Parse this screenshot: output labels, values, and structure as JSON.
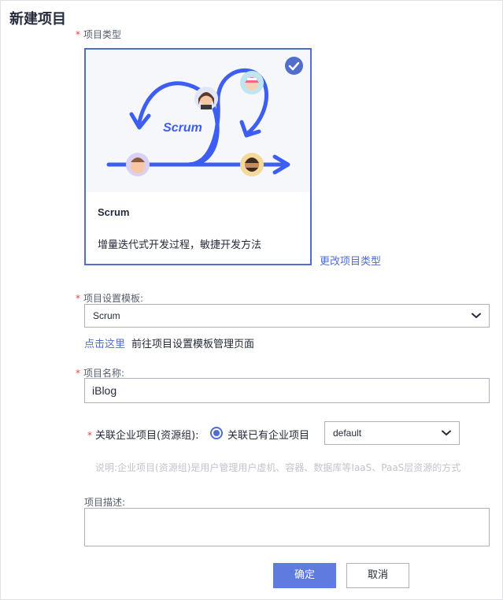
{
  "page": {
    "title": "新建项目"
  },
  "required_mark": "*",
  "project_type": {
    "label": "项目类型",
    "card": {
      "illustration_text": "Scrum",
      "title": "Scrum",
      "description": "增量迭代式开发过程，敏捷开发方法",
      "selected": true
    },
    "change_link": "更改项目类型"
  },
  "template": {
    "label": "项目设置模板:",
    "selected": "Scrum",
    "link": "点击这里",
    "link_suffix": "前往项目设置模板管理页面"
  },
  "name": {
    "label": "项目名称:",
    "value": "iBlog"
  },
  "enterprise": {
    "label": "关联企业项目(资源组):",
    "radio_label": "关联已有企业项目",
    "selected": "default",
    "hint": "说明:企业项目(资源组)是用户管理用户虚机、容器、数据库等IaaS、PaaS层资源的方式"
  },
  "description": {
    "label": "项目描述:",
    "value": ""
  },
  "buttons": {
    "ok": "确定",
    "cancel": "取消"
  },
  "colors": {
    "accent": "#526ecc",
    "primary_button": "#5e7ce0",
    "required": "#e54545"
  },
  "icons": {
    "selected": "check-circle-icon",
    "dropdown": "chevron-down-icon"
  }
}
